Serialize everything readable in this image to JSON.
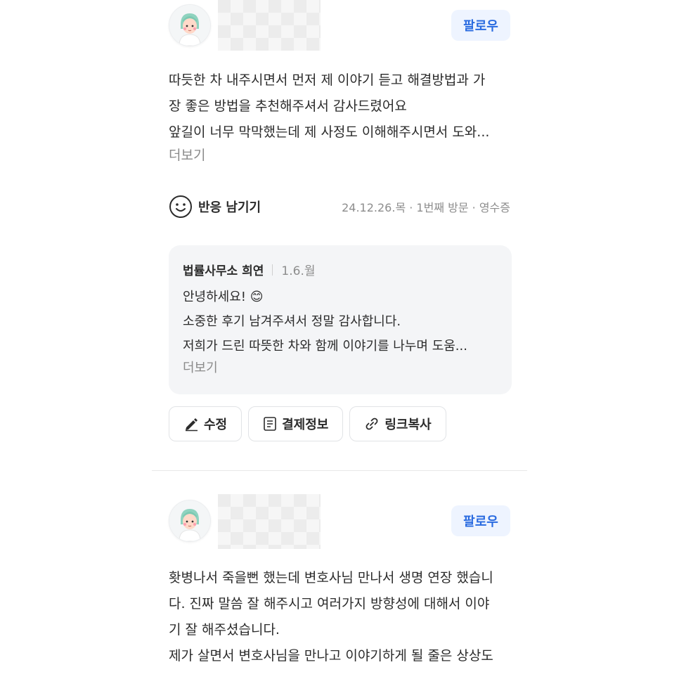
{
  "reviews": [
    {
      "follow_label": "팔로우",
      "body": "따듯한 차 내주시면서 먼저 제 이야기 듣고 해결방법과 가\n장 좋은 방법을 추천해주셔서 감사드렸어요\n앞길이 너무 막막했는데 제 사정도 이해해주시면서 도와...",
      "more_label": "더보기",
      "reaction_label": "반응 남기기",
      "visit_meta": "24.12.26.목 · 1번째 방문 · 영수증",
      "owner_reply": {
        "name": "법률사무소 희연",
        "date": "1.6.월",
        "text": "안녕하세요! 😊\n소중한 후기 남겨주셔서 정말 감사합니다.\n저희가 드린 따뜻한 차와 함께 이야기를 나누며 도움...",
        "more_label": "더보기"
      },
      "actions": [
        {
          "label": "수정",
          "icon": "pencil-icon"
        },
        {
          "label": "결제정보",
          "icon": "receipt-icon"
        },
        {
          "label": "링크복사",
          "icon": "link-icon"
        }
      ]
    },
    {
      "follow_label": "팔로우",
      "body": "홧병나서 죽을뻔 했는데 변호사님 만나서 생명 연장 했습니\n다. 진짜 말씀 잘 해주시고 여러가지 방향성에 대해서 이야\n기 잘 해주셨습니다.\n제가 살면서 변호사님을 만나고 이야기하게 될 줄은 상상도"
    }
  ],
  "colors": {
    "accent": "#2a6be0",
    "follow_bg": "#eef4ff",
    "reply_bg": "#f4f5f7",
    "muted_text": "#8d8d8d"
  }
}
